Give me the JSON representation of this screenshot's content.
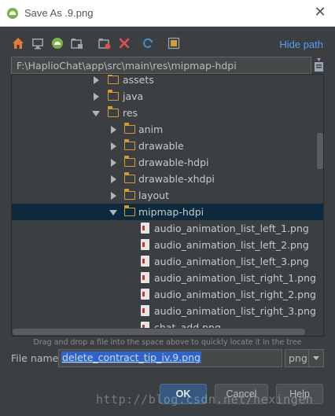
{
  "window": {
    "title": "Save As .9.png",
    "close_glyph": "✕"
  },
  "toolbar": {
    "icons": [
      "home-icon",
      "desktop-icon",
      "android-project-icon",
      "module-icon",
      "new-folder-icon",
      "delete-icon",
      "refresh-icon",
      "show-hidden-icon"
    ],
    "hide_path_label": "Hide path"
  },
  "path": {
    "value": "F:\\HaplioChat\\app\\src\\main\\res\\mipmap-hdpi"
  },
  "tree": {
    "rows": [
      {
        "label": "assets",
        "kind": "folder",
        "expanded": false
      },
      {
        "label": "java",
        "kind": "folder",
        "expanded": false
      },
      {
        "label": "res",
        "kind": "folder",
        "expanded": true
      },
      {
        "label": "anim",
        "kind": "folder",
        "expanded": false
      },
      {
        "label": "drawable",
        "kind": "folder",
        "expanded": false
      },
      {
        "label": "drawable-hdpi",
        "kind": "folder",
        "expanded": false
      },
      {
        "label": "drawable-xhdpi",
        "kind": "folder",
        "expanded": false
      },
      {
        "label": "layout",
        "kind": "folder",
        "expanded": false
      },
      {
        "label": "mipmap-hdpi",
        "kind": "folder",
        "expanded": true,
        "selected": true
      },
      {
        "label": "audio_animation_list_left_1.png",
        "kind": "file"
      },
      {
        "label": "audio_animation_list_left_2.png",
        "kind": "file"
      },
      {
        "label": "audio_animation_list_left_3.png",
        "kind": "file"
      },
      {
        "label": "audio_animation_list_right_1.png",
        "kind": "file"
      },
      {
        "label": "audio_animation_list_right_2.png",
        "kind": "file"
      },
      {
        "label": "audio_animation_list_right_3.png",
        "kind": "file"
      },
      {
        "label": "chat_add.png",
        "kind": "file"
      }
    ]
  },
  "hint": "Drag and drop a file into the space above to quickly locate it in the tree",
  "filename": {
    "label": "File name:",
    "value": "delete_contract_tip_iv.9.png"
  },
  "extension": {
    "value": "png"
  },
  "buttons": {
    "ok": "OK",
    "cancel": "Cancel",
    "help": "Help"
  },
  "watermark": "http://blog.csdn.net/hexingen",
  "colors": {
    "accent": "#589df6",
    "selection": "#0d293e",
    "folder": "#d69b36",
    "background": "#3c3f41"
  }
}
